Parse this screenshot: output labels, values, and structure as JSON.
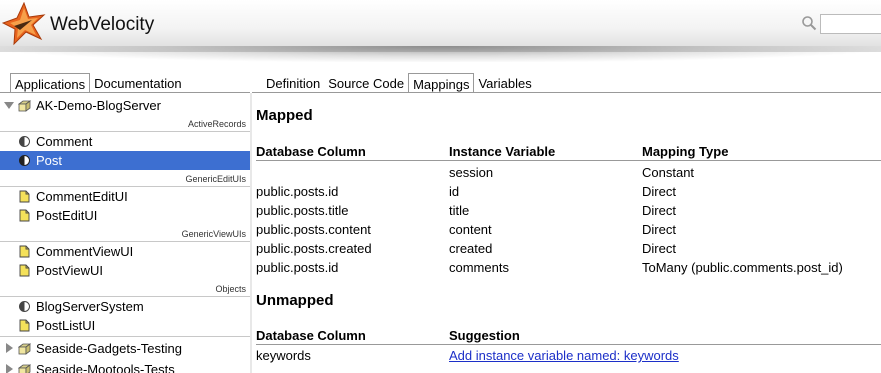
{
  "app": {
    "title": "WebVelocity"
  },
  "search": {
    "placeholder": "",
    "value": ""
  },
  "left_tabs": [
    {
      "label": "Applications",
      "active": true
    },
    {
      "label": "Documentation",
      "active": false
    }
  ],
  "right_tabs": [
    {
      "label": "Definition",
      "active": false
    },
    {
      "label": "Source Code",
      "active": false
    },
    {
      "label": "Mappings",
      "active": true
    },
    {
      "label": "Variables",
      "active": false
    }
  ],
  "sidebar": {
    "root": {
      "label": "AK-Demo-BlogServer",
      "expanded": true
    },
    "sections": [
      {
        "title": "ActiveRecords",
        "items": [
          {
            "label": "Comment",
            "icon": "class-icon",
            "selected": false
          },
          {
            "label": "Post",
            "icon": "class-icon",
            "selected": true
          }
        ]
      },
      {
        "title": "GenericEditUIs",
        "items": [
          {
            "label": "CommentEditUI",
            "icon": "page-icon",
            "selected": false
          },
          {
            "label": "PostEditUI",
            "icon": "page-icon",
            "selected": false
          }
        ]
      },
      {
        "title": "GenericViewUIs",
        "items": [
          {
            "label": "CommentViewUI",
            "icon": "page-icon",
            "selected": false
          },
          {
            "label": "PostViewUI",
            "icon": "page-icon",
            "selected": false
          }
        ]
      },
      {
        "title": "Objects",
        "items": [
          {
            "label": "BlogServerSystem",
            "icon": "class-icon",
            "selected": false
          },
          {
            "label": "PostListUI",
            "icon": "page-icon",
            "selected": false
          }
        ]
      }
    ],
    "other_packages": [
      {
        "label": "Seaside-Gadgets-Testing",
        "expanded": false
      },
      {
        "label": "Seaside-Mootools-Tests",
        "expanded": false
      }
    ]
  },
  "mapped": {
    "heading": "Mapped",
    "columns": [
      "Database Column",
      "Instance Variable",
      "Mapping Type"
    ],
    "rows": [
      [
        "",
        "session",
        "Constant"
      ],
      [
        "public.posts.id",
        "id",
        "Direct"
      ],
      [
        "public.posts.title",
        "title",
        "Direct"
      ],
      [
        "public.posts.content",
        "content",
        "Direct"
      ],
      [
        "public.posts.created",
        "created",
        "Direct"
      ],
      [
        "public.posts.id",
        "comments",
        "ToMany (public.comments.post_id)"
      ]
    ]
  },
  "unmapped": {
    "heading": "Unmapped",
    "columns": [
      "Database Column",
      "Suggestion"
    ],
    "rows": [
      [
        "keywords",
        "Add instance variable named: keywords"
      ]
    ]
  },
  "colors": {
    "selection": "#3d6fd1",
    "link": "#1c2fc8",
    "logo": "#e8641e"
  }
}
